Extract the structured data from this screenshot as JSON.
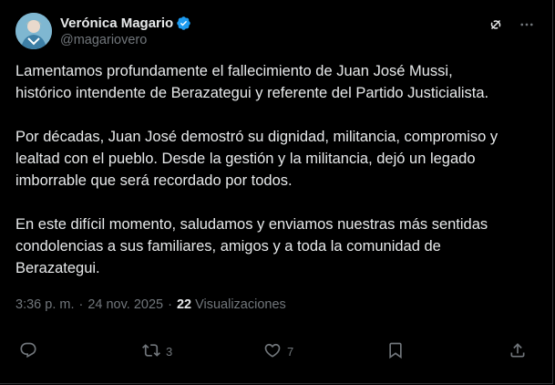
{
  "author": {
    "display_name": "Verónica Magario",
    "handle": "@magariovero",
    "verified": true
  },
  "body": {
    "paragraphs": [
      "Lamentamos profundamente el fallecimiento de Juan José Mussi,\nhistórico intendente de Berazategui y referente del Partido Justicialista.",
      "Por décadas, Juan José demostró su dignidad, militancia, compromiso y\nlealtad con el pueblo. Desde la gestión y la militancia, dejó un legado\nimborrable que será recordado por todos.",
      "En este difícil momento, saludamos y enviamos nuestras más sentidas\ncondolencias a sus familiares, amigos y a toda la comunidad de\nBerazategui."
    ]
  },
  "meta": {
    "time": "3:36 p. m.",
    "separator1": "·",
    "date": "24 nov. 2025",
    "separator2": "·",
    "views_count": "22",
    "views_label": "Visualizaciones"
  },
  "actions": {
    "reply_count": "",
    "retweet_count": "3",
    "like_count": "7"
  },
  "icons": {
    "grok": "grok-icon",
    "more": "more-icon",
    "reply": "reply-icon",
    "retweet": "retweet-icon",
    "like": "like-icon",
    "bookmark": "bookmark-icon",
    "share": "share-icon"
  },
  "colors": {
    "background": "#000000",
    "text": "#e7e9ea",
    "secondary": "#71767b",
    "verified": "#1d9bf0",
    "border": "#2f3336"
  }
}
